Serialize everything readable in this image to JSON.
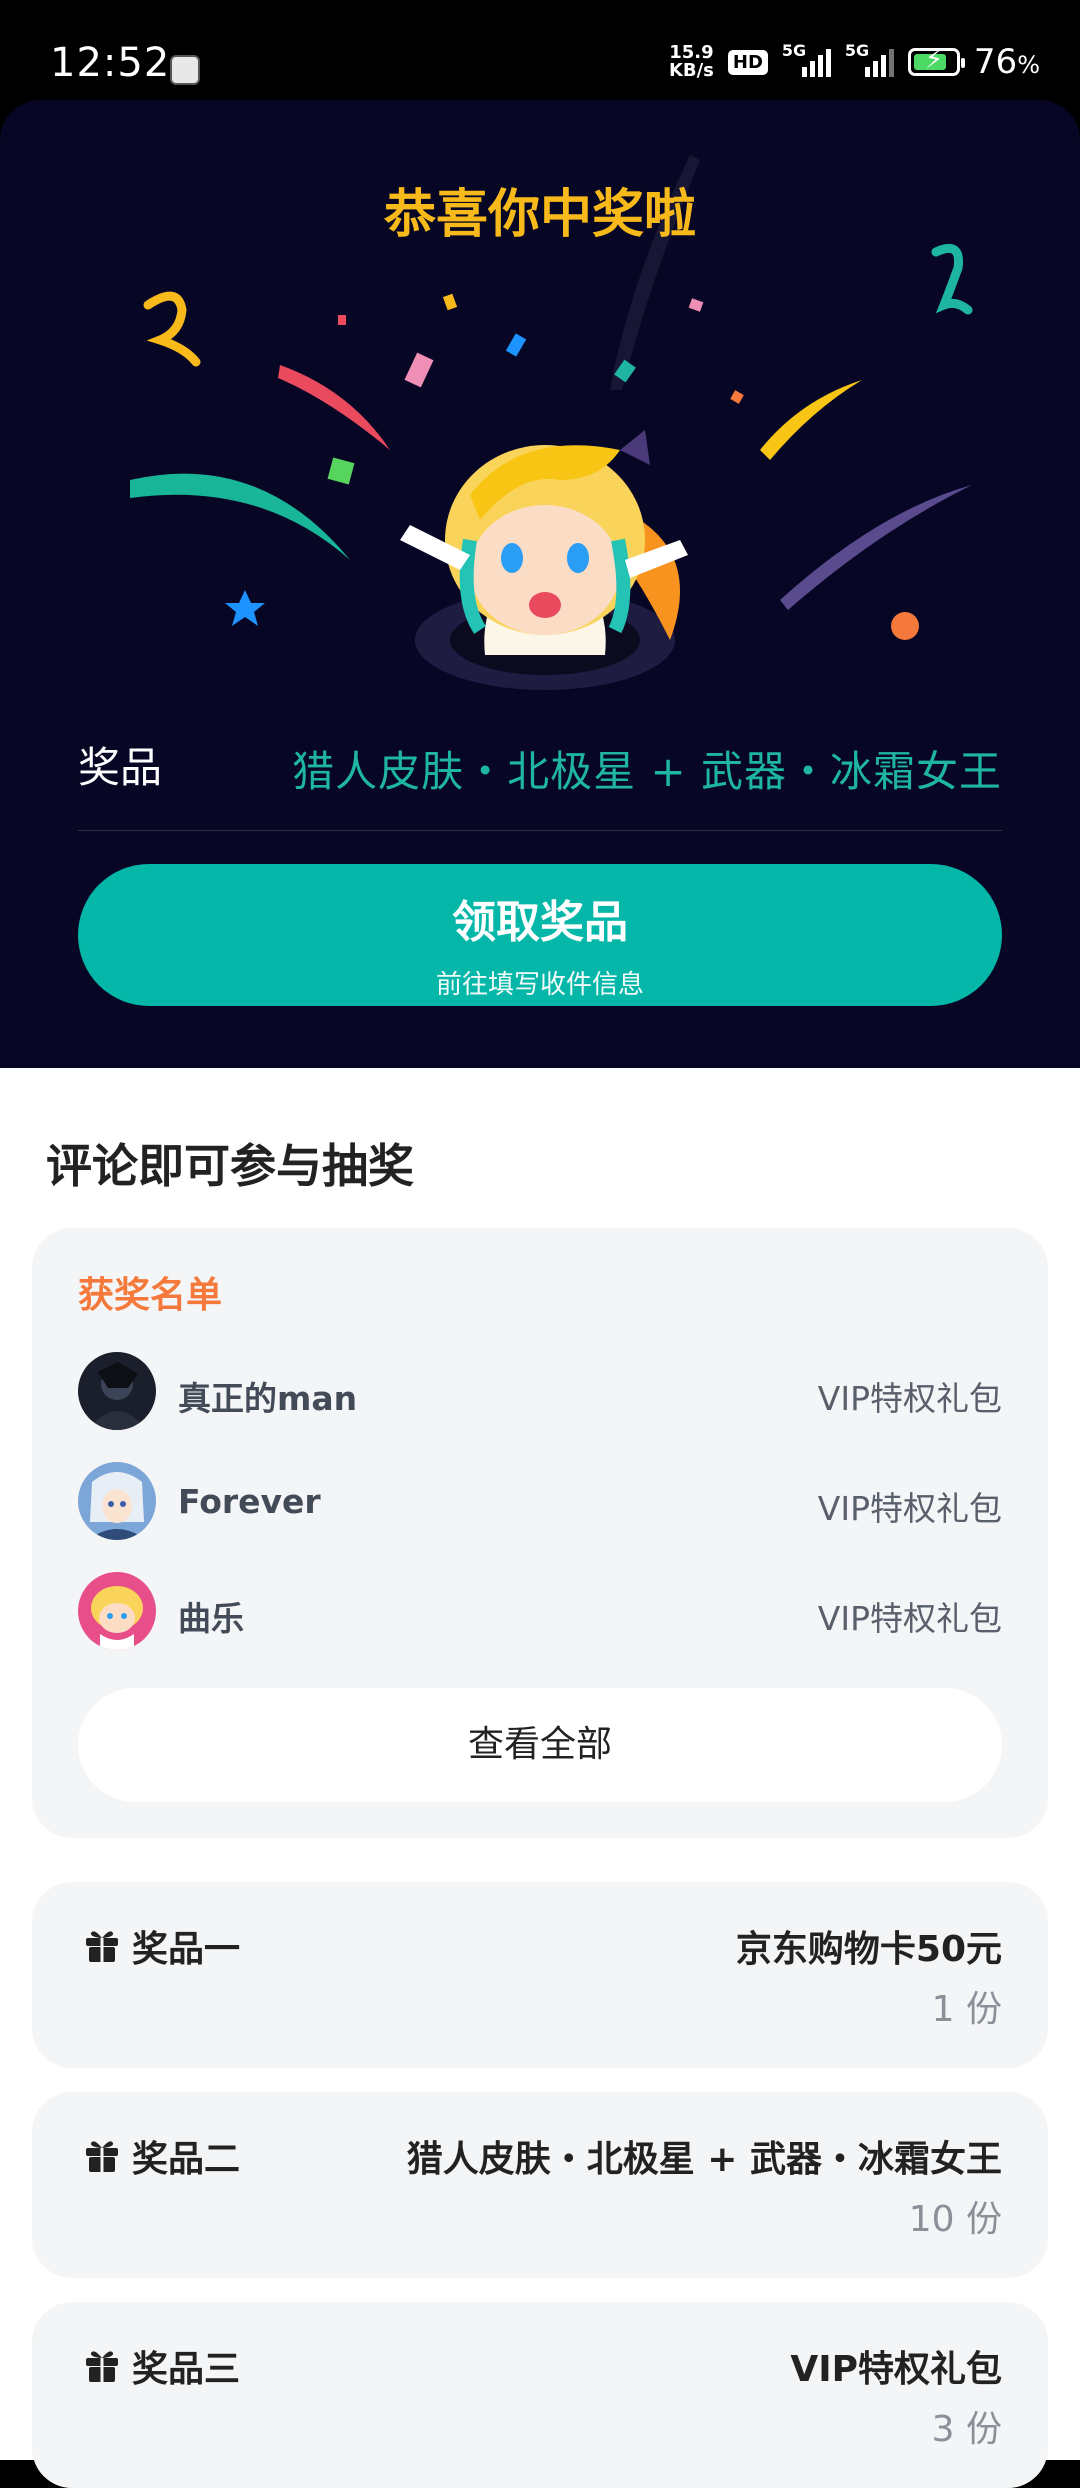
{
  "status_bar": {
    "time": "12:52",
    "net_speed_value": "15.9",
    "net_speed_unit": "KB/s",
    "hd_badge": "HD",
    "signal1_label": "5G",
    "signal2_label": "5G",
    "battery_percent": "76",
    "battery_percent_suffix": "%"
  },
  "hero": {
    "title": "恭喜你中奖啦",
    "prize_label": "奖品",
    "prize_value": "猎人皮肤・北极星 + 武器・冰霜女王",
    "claim_title": "领取奖品",
    "claim_subtitle": "前往填写收件信息"
  },
  "section_title": "评论即可参与抽奖",
  "winners": {
    "title": "获奖名单",
    "items": [
      {
        "name": "真正的man",
        "prize": "VIP特权礼包"
      },
      {
        "name": "Forever",
        "prize": "VIP特权礼包"
      },
      {
        "name": "曲乐",
        "prize": "VIP特权礼包"
      }
    ],
    "view_all": "查看全部"
  },
  "prizes": [
    {
      "name": "奖品一",
      "value": "京东购物卡50元",
      "count": "1 份"
    },
    {
      "name": "奖品二",
      "value": "猎人皮肤・北极星 + 武器・冰霜女王",
      "count": "10 份"
    },
    {
      "name": "奖品三",
      "value": "VIP特权礼包",
      "count": "3 份"
    }
  ],
  "colors": {
    "accent_teal": "#05b7a8",
    "title_gold": "#f8b91a",
    "winners_orange": "#f4793b",
    "hero_bg": "#070624"
  }
}
